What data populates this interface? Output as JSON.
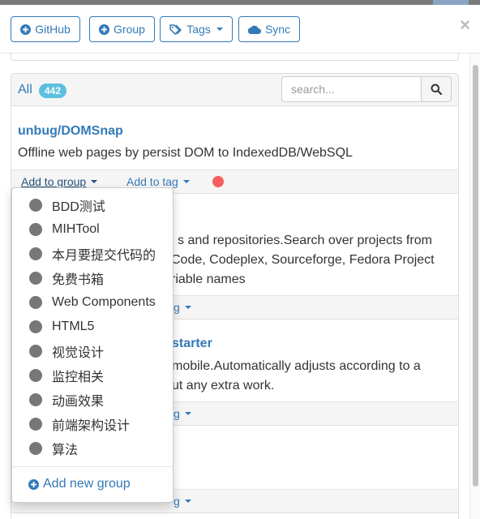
{
  "toolbar": {
    "github_label": "GitHub",
    "group_label": "Group",
    "tags_label": "Tags",
    "sync_label": "Sync",
    "close_label": "×"
  },
  "list": {
    "all_label": "All",
    "count": "442",
    "search_placeholder": "search..."
  },
  "repos": [
    {
      "title": "unbug/DOMSnap",
      "description": "Offline web pages by persist DOM to IndexedDB/WebSQL",
      "add_to_group": "Add to group",
      "add_to_tag": "Add to tag",
      "status_color": "#f75f5f"
    },
    {
      "title": "",
      "description_lines": [
        "s and repositories.Search over projects from",
        "Code, Codeplex, Sourceforge, Fedora Project",
        "riable names"
      ],
      "add_to_tag_partial": "g"
    },
    {
      "title_partial": "starter",
      "description_lines": [
        "mobile.Automatically adjusts according to a",
        "ut any extra work."
      ],
      "add_to_tag_partial": "g"
    },
    {
      "add_to_tag_partial": "g"
    }
  ],
  "group_dropdown": {
    "items": [
      "BDD测试",
      "MIHTool",
      "本月要提交代码的",
      "免费书箱",
      "Web Components",
      "HTML5",
      "视觉设计",
      "监控相关",
      "动画效果",
      "前端架构设计",
      "算法"
    ],
    "add_new_label": "Add new group"
  },
  "colors": {
    "accent": "#337ab7",
    "badge": "#5bc0de",
    "group_dot": "#777777",
    "status_dot": "#f75f5f"
  }
}
